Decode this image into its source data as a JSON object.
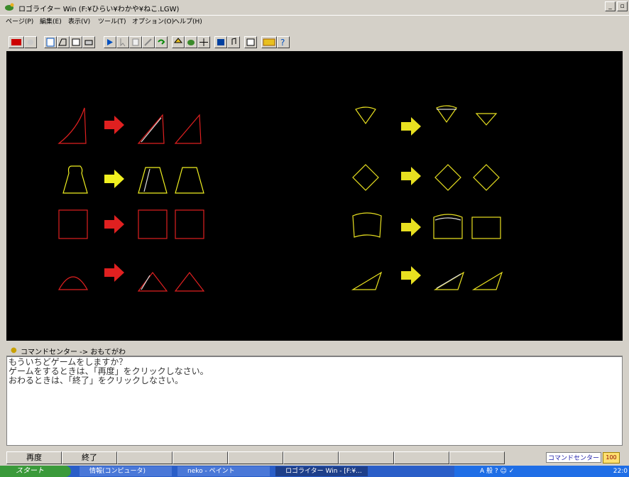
{
  "window": {
    "title": "ロゴライター Win (F:¥ひらい¥わかや¥ねこ.LGW)",
    "buttons": {
      "minimize": "_",
      "maximize": "▫"
    }
  },
  "menu": [
    "ページ(P)",
    "編集(E)",
    "表示(V)",
    "ツール(T)",
    "オプション(O)",
    "ヘルプ(H)"
  ],
  "canvas": {
    "background": "#000000",
    "left_panel_colors": {
      "red": "#e02020",
      "yellow": "#f0f020"
    },
    "right_panel_color": "#e8e020"
  },
  "command_center": {
    "header": "コマンドセンター -> おもてがわ",
    "lines": [
      "もういちどゲームをしますか？",
      "ゲームをするときは、「再度」をクリックしなさい。",
      "おわるときは、「終了」をクリックしなさい。"
    ]
  },
  "buttons": {
    "retry": "再度",
    "quit": "終了",
    "cc_link": "コマンドセンター"
  },
  "taskbar": {
    "start": "スタート",
    "tasks": [
      "情報(コンピュータ)",
      "neko - ペイント",
      "ロゴライター Win - [F:¥..."
    ],
    "tray": "A 般 ? ☺ ✓",
    "clock": "22:0"
  }
}
